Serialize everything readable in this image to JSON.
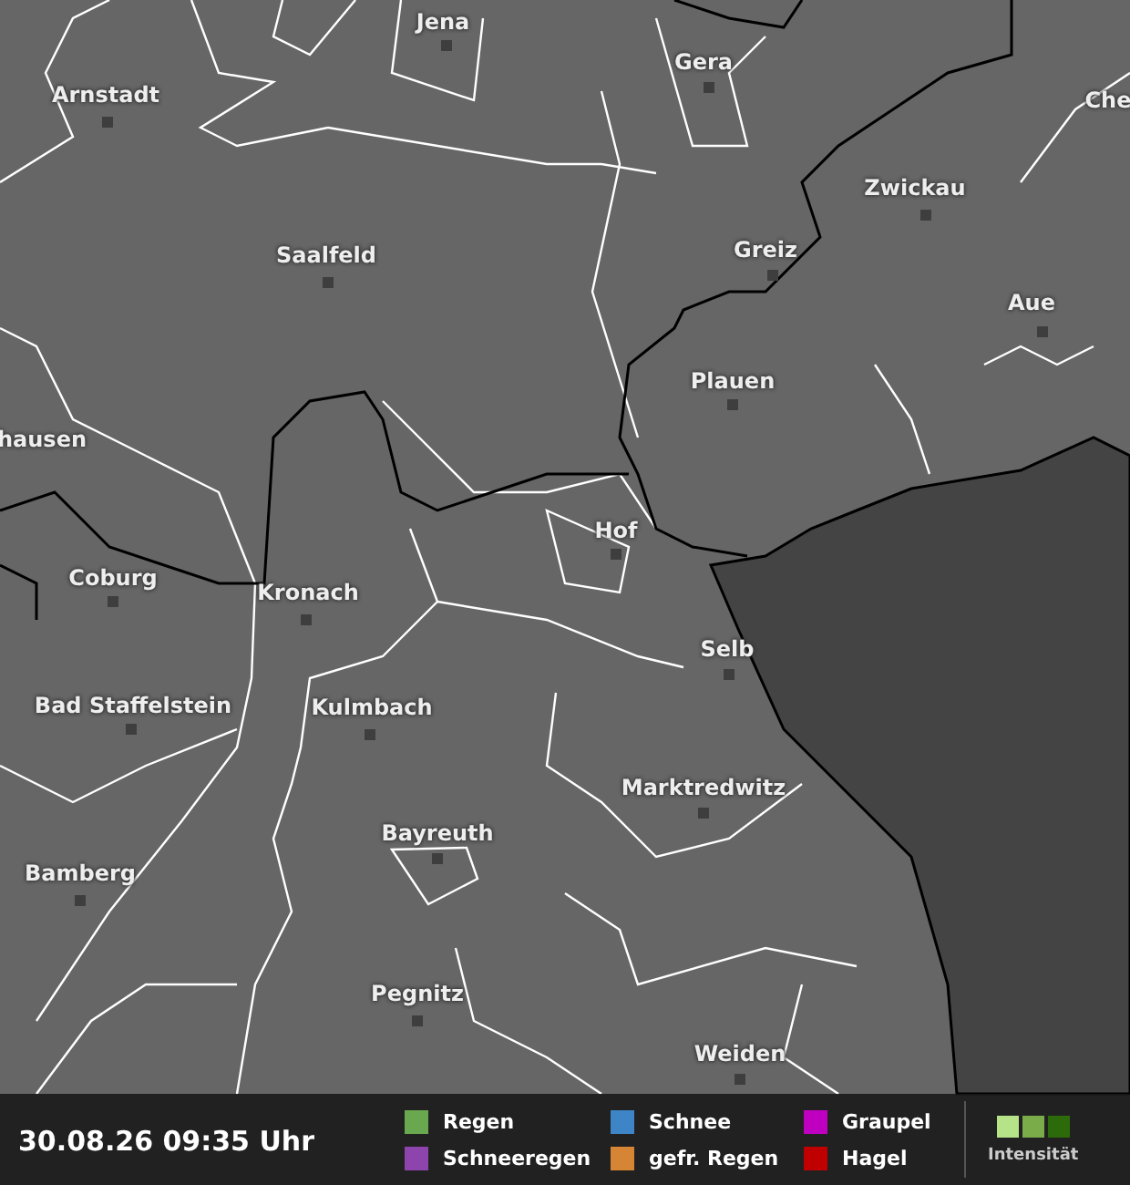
{
  "map": {
    "cities": [
      {
        "name": "Jena"
      },
      {
        "name": "Gera"
      },
      {
        "name": "Arnstadt"
      },
      {
        "name": "Che"
      },
      {
        "name": "Zwickau"
      },
      {
        "name": "Saalfeld"
      },
      {
        "name": "Greiz"
      },
      {
        "name": "Aue"
      },
      {
        "name": "Plauen"
      },
      {
        "name": "hausen"
      },
      {
        "name": "Hof"
      },
      {
        "name": "Coburg"
      },
      {
        "name": "Kronach"
      },
      {
        "name": "Selb"
      },
      {
        "name": "Bad Staffelstein"
      },
      {
        "name": "Kulmbach"
      },
      {
        "name": "Marktredwitz"
      },
      {
        "name": "Bayreuth"
      },
      {
        "name": "Bamberg"
      },
      {
        "name": "Pegnitz"
      },
      {
        "name": "Weiden"
      }
    ]
  },
  "footer": {
    "timestamp": "30.08.26 09:35 Uhr",
    "legend": [
      {
        "label": "Regen",
        "color": "#6aa84f"
      },
      {
        "label": "Schneeregen",
        "color": "#8e44ad"
      },
      {
        "label": "Schnee",
        "color": "#3d85c6"
      },
      {
        "label": "gefr. Regen",
        "color": "#d68535"
      },
      {
        "label": "Graupel",
        "color": "#c000c0"
      },
      {
        "label": "Hagel",
        "color": "#c00000"
      }
    ],
    "intensity": {
      "label": "Intensität",
      "levels": [
        {
          "color": "#b6e388"
        },
        {
          "color": "#7aad4a"
        },
        {
          "color": "#2d6a0a"
        }
      ]
    }
  }
}
